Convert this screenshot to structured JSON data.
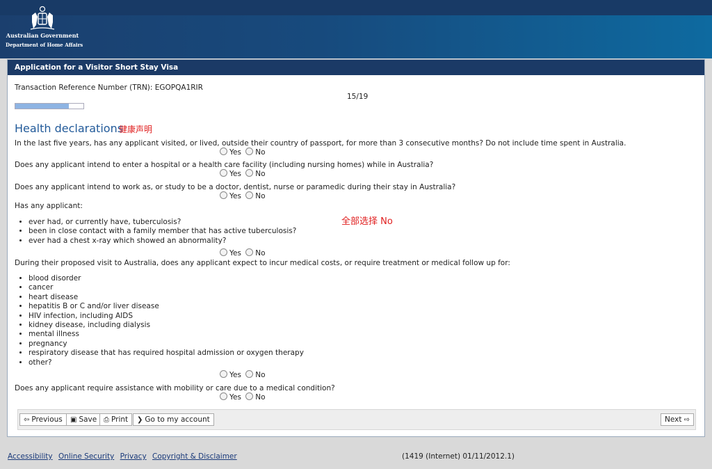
{
  "header": {
    "org_line1": "Australian Government",
    "org_line2": "Department of Home Affairs"
  },
  "panel": {
    "title": "Application for a Visitor Short Stay Visa",
    "trn": "Transaction Reference Number (TRN): EGOPQA1RIR",
    "step": "15/19",
    "progress": 0.79
  },
  "section": {
    "title": "Health declarations",
    "note_cn": "健康声明",
    "note_cn_all_no": "全部选择 No"
  },
  "options": {
    "yes": "Yes",
    "no": "No"
  },
  "questions": [
    {
      "text": "In the last five years, has any applicant visited, or lived, outside their country of passport, for more than 3 consecutive months? Do not include time spent in Australia."
    },
    {
      "text": "Does any applicant intend to enter a hospital or a health care facility (including nursing homes) while in Australia?"
    },
    {
      "text": "Does any applicant intend to work as, or study to be a doctor, dentist, nurse or paramedic during their stay in Australia?"
    },
    {
      "text": "Has any applicant:",
      "bullets": [
        "ever had, or currently have, tuberculosis?",
        "been in close contact with a family member that has active tuberculosis?",
        "ever had a chest x-ray which showed an abnormality?"
      ]
    },
    {
      "text": "During their proposed visit to Australia, does any applicant expect to incur medical costs, or require treatment or medical follow up for:",
      "bullets": [
        "blood disorder",
        "cancer",
        "heart disease",
        "hepatitis B or C and/or liver disease",
        "HIV infection, including AIDS",
        "kidney disease, including dialysis",
        "mental illness",
        "pregnancy",
        "respiratory disease that has required hospital admission or oxygen therapy",
        "other?"
      ]
    },
    {
      "text": "Does any applicant require assistance with mobility or care due to a medical condition?"
    }
  ],
  "buttons": {
    "previous": "Previous",
    "save": "Save",
    "print": "Print",
    "account": "Go to my account",
    "next": "Next"
  },
  "icons": {
    "previous": "arrow-left-outline-icon",
    "save": "floppy-disk-icon",
    "print": "printer-icon",
    "account": "chevron-right-icon",
    "next": "arrow-right-outline-icon"
  },
  "footer": {
    "links": [
      "Accessibility",
      "Online Security",
      "Privacy",
      "Copyright & Disclaimer"
    ],
    "version": "(1419 (Internet) 01/11/2012.1)"
  }
}
